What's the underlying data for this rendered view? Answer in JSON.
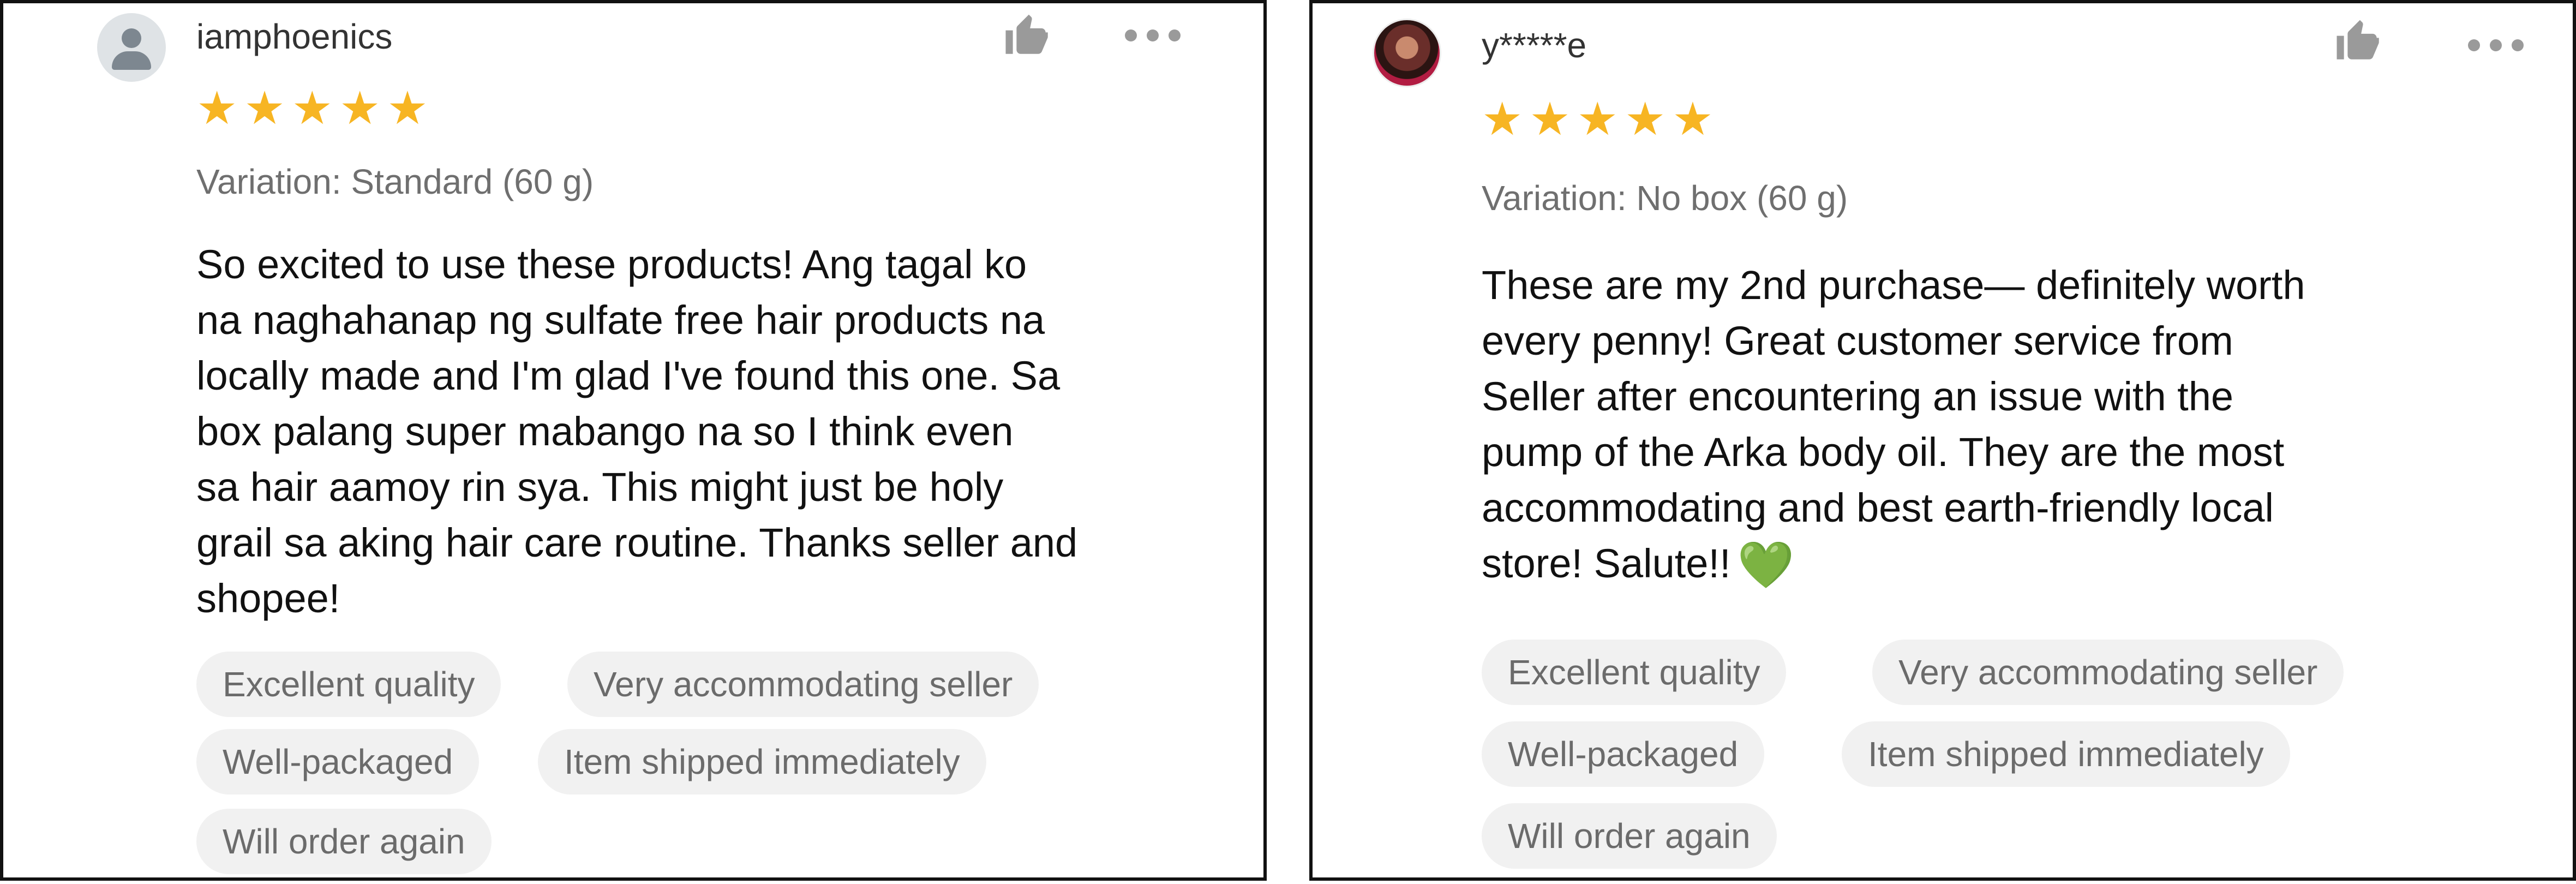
{
  "reviews": [
    {
      "username": "iamphoenics",
      "rating": 5,
      "variation": "Variation: Standard (60 g)",
      "text": "So excited to use these products! Ang tagal ko\nna naghahanap ng sulfate free hair products na\nlocally made and I'm glad I've found this one. Sa\nbox palang super mabango na so I think even\nsa hair aamoy rin sya. This might just be holy\ngrail sa aking hair care routine. Thanks seller and\nshopee!",
      "tags": [
        "Excellent quality",
        "Very accommodating seller",
        "Well-packaged",
        "Item shipped immediately",
        "Will order again"
      ]
    },
    {
      "username": "y*****e",
      "rating": 5,
      "variation": "Variation: No box (60 g)",
      "text": "These are my 2nd purchase— definitely worth\nevery penny! Great customer service from\nSeller after encountering an issue with the\npump of the Arka body oil. They are the most\naccommodating and best earth-friendly local\nstore! Salute!!",
      "emoji": "💚",
      "tags": [
        "Excellent quality",
        "Very accommodating seller",
        "Well-packaged",
        "Item shipped immediately",
        "Will order again"
      ]
    }
  ],
  "icons": {
    "like": "thumbs-up-icon",
    "more": "more-options-icon",
    "star": "star-icon",
    "heart": "green-heart-emoji"
  },
  "colors": {
    "star": "#f7b523",
    "tag_bg": "#f1f1f1",
    "tag_text": "#6b6b6b",
    "icon": "#9a9a9a",
    "heart": "#6fbf3a"
  }
}
